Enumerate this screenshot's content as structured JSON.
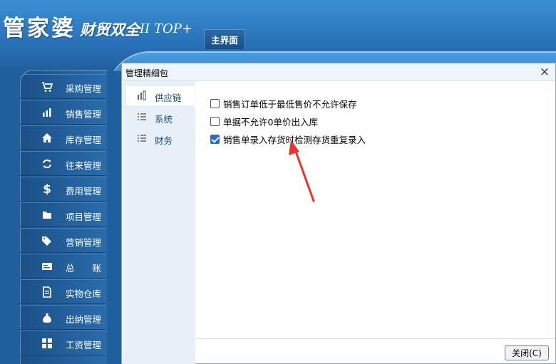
{
  "app": {
    "logo_cn": "管家婆",
    "logo_sub": "财贸双全",
    "logo_sub2": "II TOP+",
    "main_tab": "主界面"
  },
  "sidebar": {
    "items": [
      {
        "label": "采购管理",
        "icon": "cart-icon"
      },
      {
        "label": "销售管理",
        "icon": "bar-chart-icon"
      },
      {
        "label": "库存管理",
        "icon": "home-icon"
      },
      {
        "label": "往来管理",
        "icon": "refresh-icon"
      },
      {
        "label": "费用管理",
        "icon": "dollar-icon"
      },
      {
        "label": "项目管理",
        "icon": "folder-icon"
      },
      {
        "label": "营销管理",
        "icon": "tag-icon"
      },
      {
        "label": "总　　账",
        "icon": "ledger-icon"
      },
      {
        "label": "实物仓库",
        "icon": "document-icon"
      },
      {
        "label": "出纳管理",
        "icon": "money-bag-icon"
      },
      {
        "label": "工资管理",
        "icon": "grid-icon"
      }
    ]
  },
  "dialog": {
    "title": "管理精细包",
    "close_glyph": "×",
    "nav": [
      {
        "label": "供应链",
        "active": true
      },
      {
        "label": "系统",
        "active": false
      },
      {
        "label": "财务",
        "active": false
      }
    ],
    "options": [
      {
        "label": "销售订单低于最低售价不允许保存",
        "checked": false
      },
      {
        "label": "单据不允许0单价出入库",
        "checked": false
      },
      {
        "label": "销售单录入存货时检测存货重复录入",
        "checked": true
      }
    ],
    "close_button": "关闭(C)"
  },
  "colors": {
    "accent": "#1e6fd0",
    "annotation_arrow": "#e8352b"
  }
}
